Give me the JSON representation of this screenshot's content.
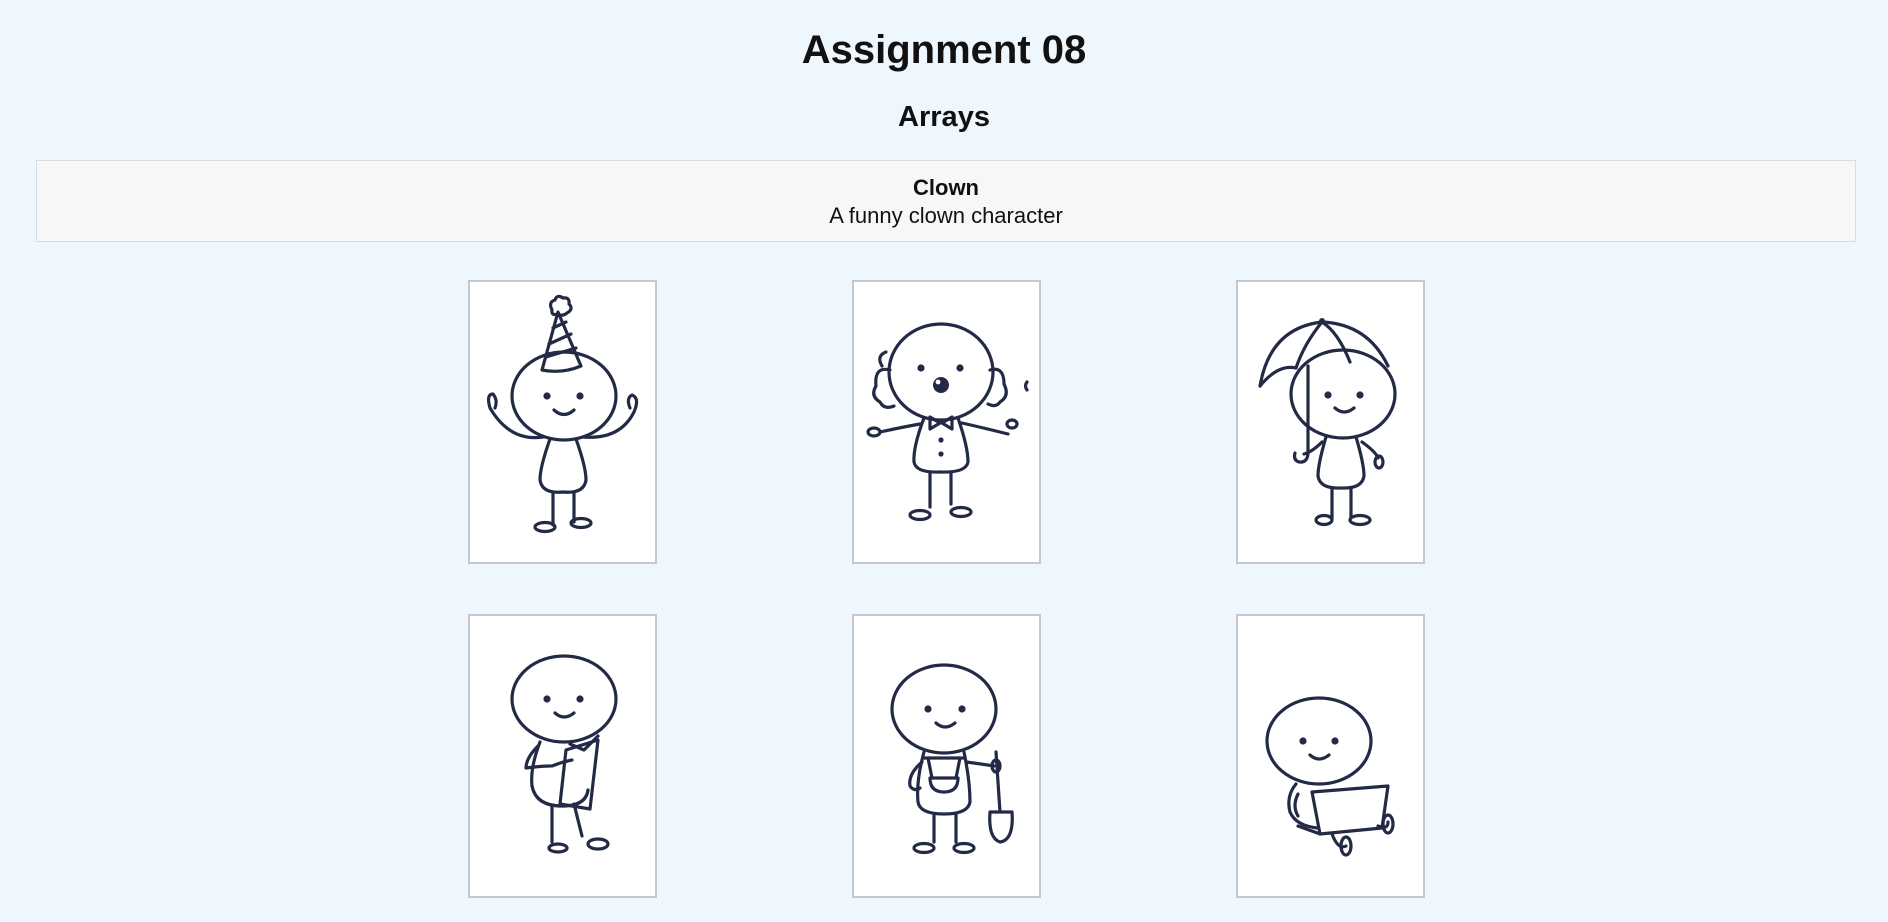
{
  "header": {
    "title": "Assignment 08",
    "subtitle": "Arrays"
  },
  "selected": {
    "name": "Clown",
    "description": "A funny clown character"
  },
  "gallery": [
    {
      "icon": "party-hat-character-icon"
    },
    {
      "icon": "clown-character-icon"
    },
    {
      "icon": "umbrella-character-icon"
    },
    {
      "icon": "reading-character-icon"
    },
    {
      "icon": "gardener-character-icon"
    },
    {
      "icon": "laptop-character-icon"
    }
  ],
  "colors": {
    "background": "#eef6fe",
    "panel": "#f7f7f7",
    "ink": "#232a45",
    "card_border": "#c4c8ce"
  }
}
